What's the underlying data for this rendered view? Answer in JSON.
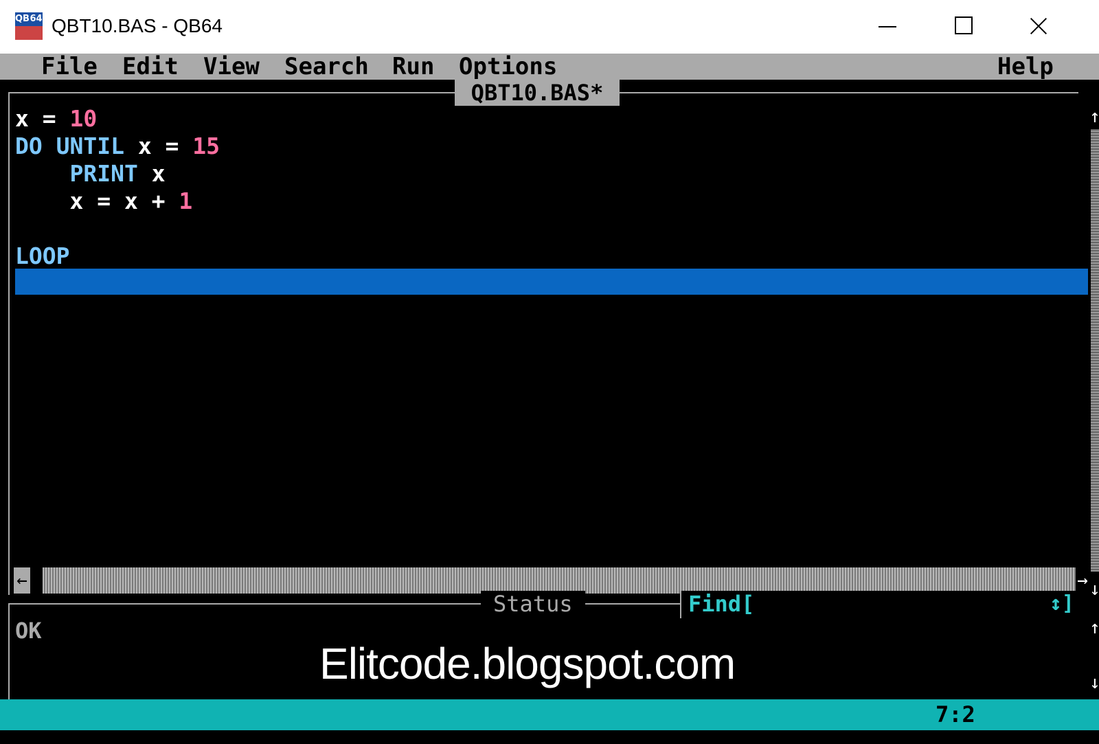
{
  "window": {
    "icon_text": [
      "QB",
      "64",
      "",
      ""
    ],
    "title": "QBT10.BAS - QB64",
    "controls": [
      "minimize",
      "maximize",
      "close"
    ]
  },
  "menu": {
    "items": [
      "File",
      "Edit",
      "View",
      "Search",
      "Run",
      "Options"
    ],
    "help": "Help"
  },
  "editor": {
    "file_tab": "QBT10.BAS*",
    "lines": [
      [
        {
          "t": "x = ",
          "c": "id"
        },
        {
          "t": "10",
          "c": "num"
        }
      ],
      [
        {
          "t": "DO UNTIL ",
          "c": "kw"
        },
        {
          "t": "x = ",
          "c": "id"
        },
        {
          "t": "15",
          "c": "num"
        }
      ],
      [
        {
          "t": "    PRINT ",
          "c": "kw"
        },
        {
          "t": "x",
          "c": "id"
        }
      ],
      [
        {
          "t": "    x = x + ",
          "c": "id"
        },
        {
          "t": "1",
          "c": "num"
        }
      ],
      [],
      [
        {
          "t": "LOOP",
          "c": "kw"
        }
      ]
    ],
    "colors": {
      "keyword": "#7ec8ff",
      "identifier": "#ffffff",
      "number": "#ff6fa0",
      "highlight": "#0a67c2"
    }
  },
  "scrollbar": {
    "up": "↑",
    "down": "↓",
    "left": "←",
    "right": "→"
  },
  "status": {
    "title": "Status",
    "find_label": "Find[",
    "find_arrows": "↕]",
    "text": "OK"
  },
  "watermark": "Elitcode.blogspot.com",
  "bottom_bar": {
    "cursor_position": "7:2",
    "color": "#10b3b3"
  }
}
